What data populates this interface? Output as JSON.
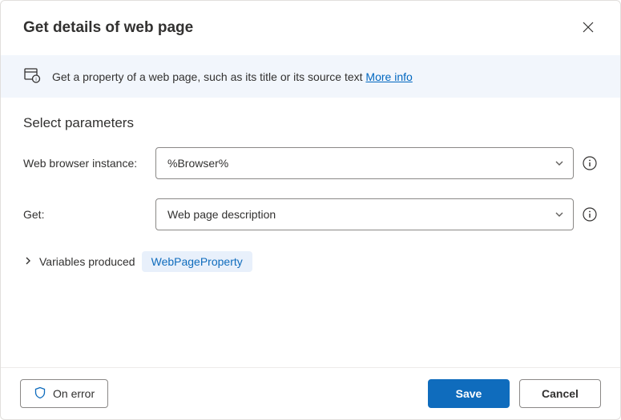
{
  "header": {
    "title": "Get details of web page"
  },
  "banner": {
    "text": "Get a property of a web page, such as its title or its source text",
    "link_text": "More info"
  },
  "section": {
    "title": "Select parameters"
  },
  "fields": {
    "browser": {
      "label": "Web browser instance:",
      "value": "%Browser%"
    },
    "get": {
      "label": "Get:",
      "value": "Web page description"
    }
  },
  "variables": {
    "label": "Variables produced",
    "badge": "WebPageProperty"
  },
  "footer": {
    "on_error": "On error",
    "save": "Save",
    "cancel": "Cancel"
  }
}
